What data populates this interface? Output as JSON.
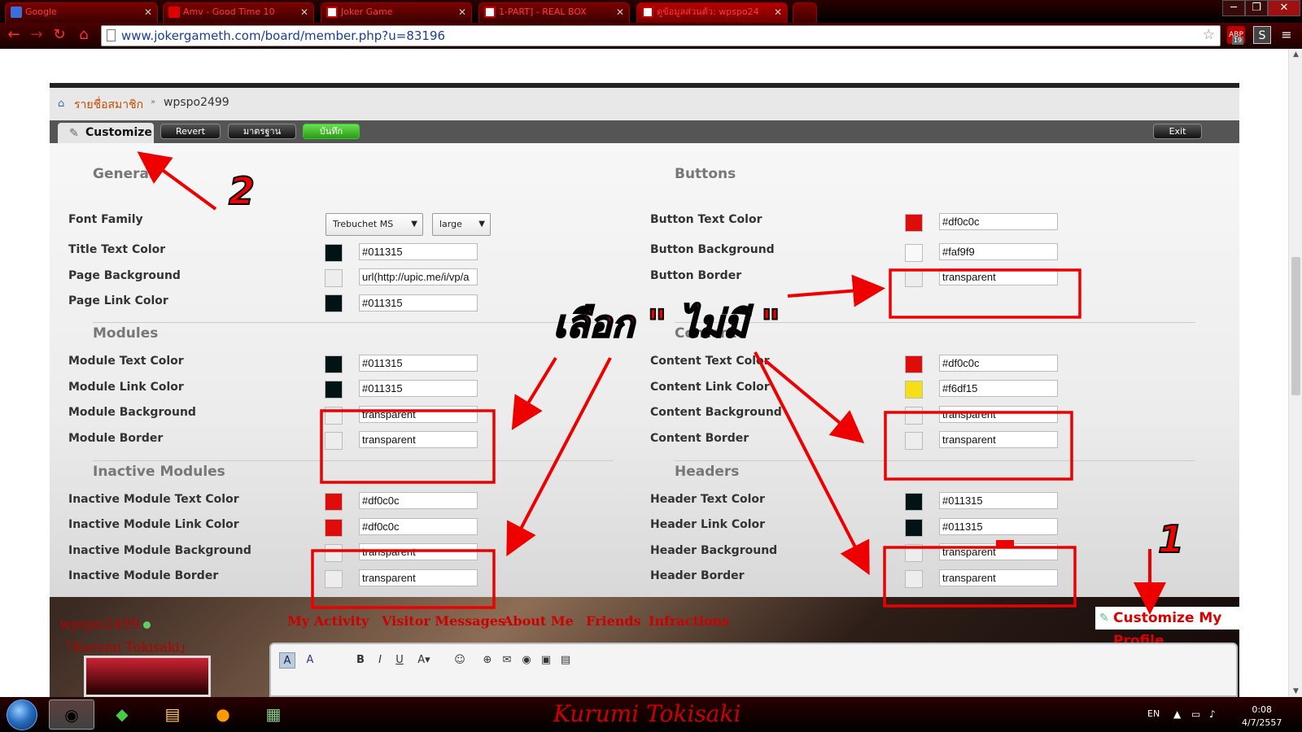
{
  "browser": {
    "tabs": [
      {
        "label": "Google",
        "color": "#3b6fd8"
      },
      {
        "label": "Amv - Good Time 10",
        "color": "#d00"
      },
      {
        "label": "Joker Game",
        "color": "#c00"
      },
      {
        "label": "1-PART] - REAL BOX",
        "color": "#c00"
      },
      {
        "label": "ดูข้อมูลส่วนตัว: wpspo24",
        "color": "#c00"
      }
    ],
    "url": "www.jokergameth.com/board/member.php?u=83196",
    "ext_abp": "ABP",
    "ext_abp_count": "19",
    "ext_s": "S"
  },
  "breadcrumb": {
    "link": "รายชื่อสมาชิก",
    "current": "wpspo2499"
  },
  "customize_bar": {
    "tab_label": "Customize",
    "revert": "Revert",
    "default": "มาตรฐาน",
    "save": "บันทึก",
    "exit": "Exit"
  },
  "general": {
    "title": "General",
    "font_family_label": "Font Family",
    "font_family_value": "Trebuchet MS",
    "font_size_value": "large",
    "rows": [
      {
        "label": "Title Text Color",
        "value": "#011315",
        "swatch": "#011315"
      },
      {
        "label": "Page Background",
        "value": "url(http://upic.me/i/vp/a",
        "swatch": ""
      },
      {
        "label": "Page Link Color",
        "value": "#011315",
        "swatch": "#011315"
      }
    ]
  },
  "modules": {
    "title": "Modules",
    "rows": [
      {
        "label": "Module Text Color",
        "value": "#011315",
        "swatch": "#011315"
      },
      {
        "label": "Module Link Color",
        "value": "#011315",
        "swatch": "#011315"
      },
      {
        "label": "Module Background",
        "value": "transparent",
        "swatch": ""
      },
      {
        "label": "Module Border",
        "value": "transparent",
        "swatch": ""
      }
    ]
  },
  "inactive_modules": {
    "title": "Inactive Modules",
    "rows": [
      {
        "label": "Inactive Module Text Color",
        "value": "#df0c0c",
        "swatch": "#df0c0c"
      },
      {
        "label": "Inactive Module Link Color",
        "value": "#df0c0c",
        "swatch": "#df0c0c"
      },
      {
        "label": "Inactive Module Background",
        "value": "transparent",
        "swatch": ""
      },
      {
        "label": "Inactive Module Border",
        "value": "transparent",
        "swatch": ""
      }
    ]
  },
  "buttons": {
    "title": "Buttons",
    "rows": [
      {
        "label": "Button Text Color",
        "value": "#df0c0c",
        "swatch": "#df0c0c"
      },
      {
        "label": "Button Background",
        "value": "#faf9f9",
        "swatch": "#faf9f9"
      },
      {
        "label": "Button Border",
        "value": "transparent",
        "swatch": ""
      }
    ]
  },
  "content": {
    "title": "Content",
    "rows": [
      {
        "label": "Content Text Color",
        "value": "#df0c0c",
        "swatch": "#df0c0c"
      },
      {
        "label": "Content Link Color",
        "value": "#f6df15",
        "swatch": "#f6df15"
      },
      {
        "label": "Content Background",
        "value": "transparent",
        "swatch": ""
      },
      {
        "label": "Content Border",
        "value": "transparent",
        "swatch": ""
      }
    ]
  },
  "headers": {
    "title": "Headers",
    "rows": [
      {
        "label": "Header Text Color",
        "value": "#011315",
        "swatch": "#011315"
      },
      {
        "label": "Header Link Color",
        "value": "#011315",
        "swatch": "#011315"
      },
      {
        "label": "Header Background",
        "value": "transparent",
        "swatch": ""
      },
      {
        "label": "Header Border",
        "value": "transparent",
        "swatch": ""
      }
    ]
  },
  "profile": {
    "username": "wpspo2499",
    "subtitle": "「Kurumi Tokisaki」",
    "tabs": [
      "My Activity",
      "Visitor Messages",
      "About Me",
      "Friends",
      "Infractions"
    ],
    "customize_link": "Customize My Profile"
  },
  "annotations": {
    "num1": "1",
    "num2": "2",
    "thai_note": "เลือก \" ไม่มี \"",
    "color": "#ee0000"
  },
  "taskbar": {
    "brand": "Kurumi Tokisaki",
    "lang": "EN",
    "time": "0:08",
    "date": "4/7/2557"
  }
}
